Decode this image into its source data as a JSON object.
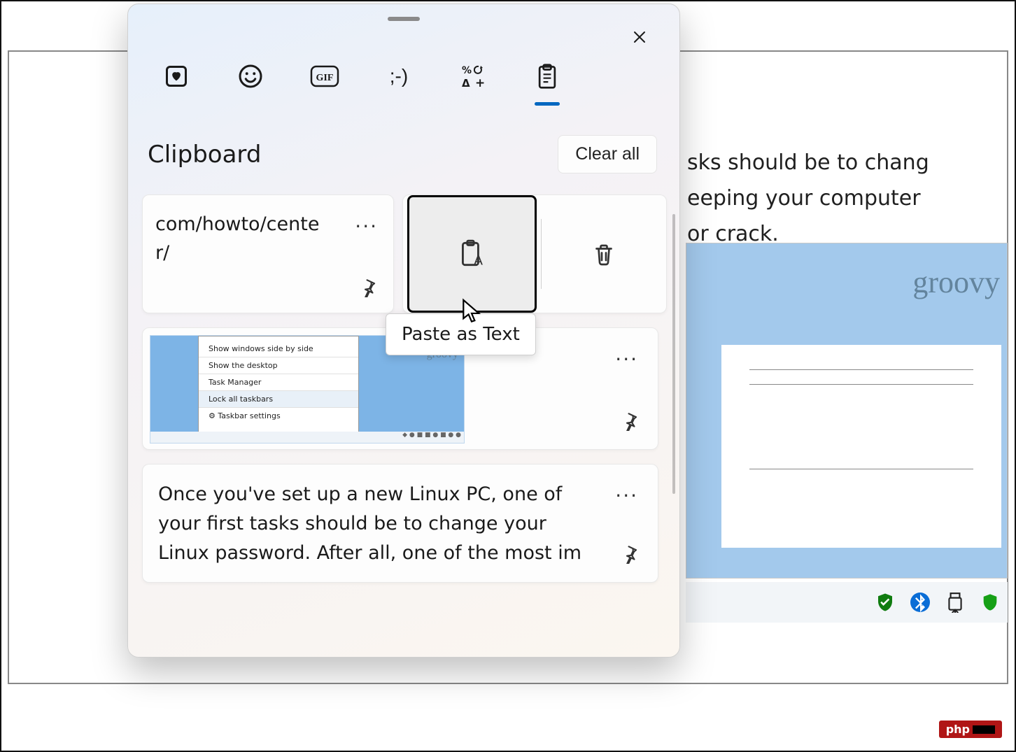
{
  "background": {
    "line1": "sks should be to chang",
    "line2": "eeping your computer",
    "line3": " or crack.",
    "image_text": "groovy"
  },
  "panel": {
    "tabs": [
      {
        "name": "recent",
        "glyph_type": "svg"
      },
      {
        "name": "emoji",
        "glyph_type": "svg"
      },
      {
        "name": "gif",
        "glyph": "GIF"
      },
      {
        "name": "kaomoji",
        "glyph": ";-)"
      },
      {
        "name": "symbols",
        "glyph": "%↻\nΔ+"
      },
      {
        "name": "clipboard",
        "glyph_type": "svg",
        "active": true
      }
    ],
    "section_title": "Clipboard",
    "clear_all": "Clear all",
    "tooltip": "Paste as Text",
    "items": [
      {
        "type": "text",
        "content": "com/howto/center/",
        "line1": "com/howto/cente",
        "line2": "r/"
      },
      {
        "type": "image",
        "thumb_menu": [
          "Show windows side by side",
          "Show the desktop",
          "Task Manager",
          "Lock all taskbars",
          "Taskbar settings"
        ],
        "thumb_text": "groovy"
      },
      {
        "type": "text",
        "content": "Once you've set up a new Linux PC, one of your first tasks should be to change your Linux password. After all, one of the most im"
      }
    ]
  },
  "watermark": "php"
}
